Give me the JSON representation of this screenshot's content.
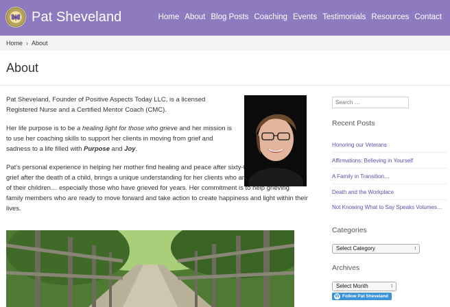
{
  "site": {
    "title": "Pat Sheveland"
  },
  "nav": {
    "items": [
      "Home",
      "About",
      "Blog Posts",
      "Coaching",
      "Events",
      "Testimonials",
      "Resources",
      "Contact"
    ]
  },
  "breadcrumb": {
    "home": "Home",
    "separator": "›",
    "current": "About"
  },
  "page": {
    "title": "About"
  },
  "content": {
    "p1": "Pat Sheveland, Founder of Positive Aspects Today LLC, is a licensed Registered Nurse and a Certified Mentor Coach (CMC).",
    "p2_a": "Her life purpose is to be ",
    "p2_em": "a healing light for those who grieve",
    "p2_b": " and her mission is to use her coaching skills to support her clients in moving from grief and sadness to a life filled with ",
    "p2_purpose": "Purpose",
    "p2_and": " and ",
    "p2_joy": "Joy",
    "p2_end": ".",
    "p3": "Pat's personal experience in helping her mother find healing and peace after sixty-three years of intense grief after the death of a child, brings a unique understanding for her clients who are grieving the death of their children… especially those who have grieved for years. Her commitment is to help grieving family members who are ready to move forward and take action to create happiness and light within their lives."
  },
  "sidebar": {
    "search_placeholder": "Search …",
    "recent_posts_title": "Recent Posts",
    "recent_posts": [
      "Honoring our Veterans",
      "Affirmations: Believing in Yourself",
      "A Family in Transition…",
      "Death and the Workplace",
      "Not Knowing What to Say Speaks Volumes…"
    ],
    "categories_title": "Categories",
    "categories_select": "Select Category",
    "archives_title": "Archives",
    "archives_select": "Select Month",
    "follow_button": "Follow Pat Sheveland"
  },
  "colors": {
    "header": "#8e7bbf",
    "link": "#5a4ea8",
    "follow": "#3b94d9"
  }
}
